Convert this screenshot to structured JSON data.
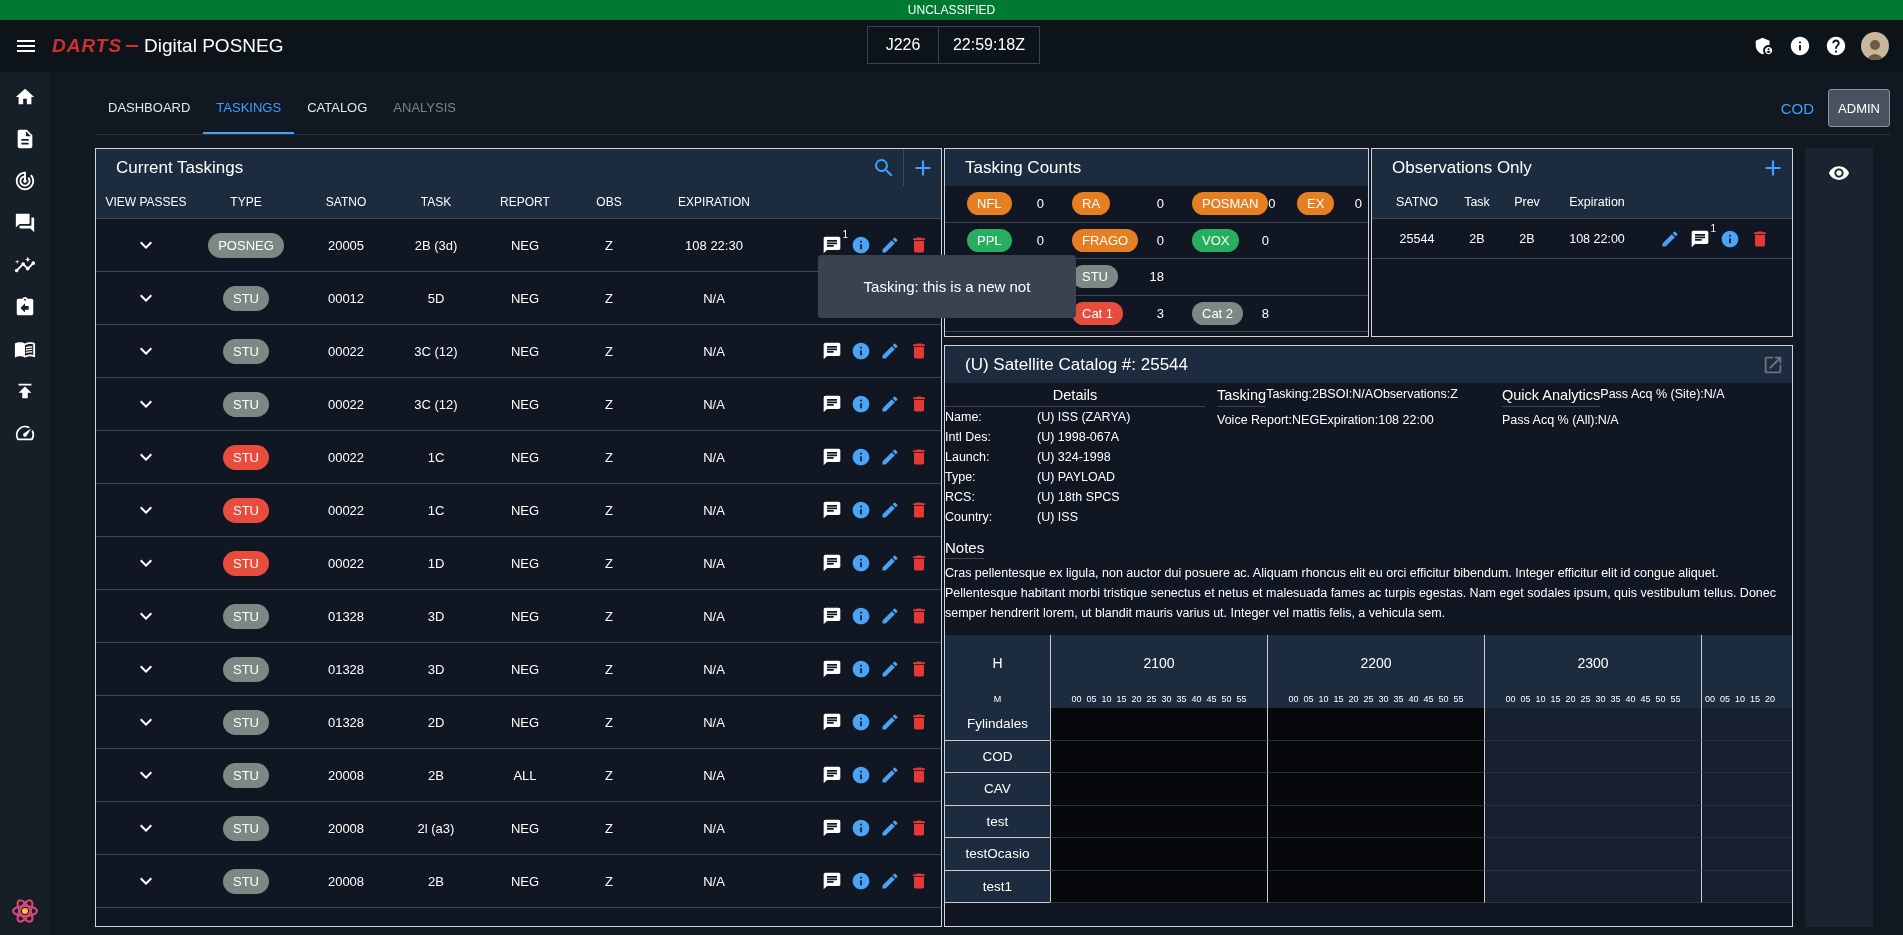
{
  "banner": "UNCLASSIFIED",
  "header": {
    "logo": "DARTS",
    "title": "Digital POSNEG",
    "julian": "J226",
    "clock": "22:59:18Z"
  },
  "nav_tabs": [
    {
      "label": "DASHBOARD",
      "selected": false,
      "disabled": false
    },
    {
      "label": "TASKINGS",
      "selected": true,
      "disabled": false
    },
    {
      "label": "CATALOG",
      "selected": false,
      "disabled": false
    },
    {
      "label": "ANALYSIS",
      "selected": false,
      "disabled": true
    }
  ],
  "site_link": "COD",
  "admin_button": "ADMIN",
  "taskings": {
    "title": "Current Taskings",
    "columns": [
      "VIEW PASSES",
      "TYPE",
      "SATNO",
      "TASK",
      "REPORT",
      "OBS",
      "EXPIRATION"
    ],
    "rows": [
      {
        "type": "POSNEG",
        "color": "#7d8784",
        "satno": "20005",
        "task": "2B (3d)",
        "report": "NEG",
        "obs": "Z",
        "expiration": "108 22:30",
        "comments": "1"
      },
      {
        "type": "STU",
        "color": "#7d8784",
        "satno": "00012",
        "task": "5D",
        "report": "NEG",
        "obs": "Z",
        "expiration": "N/A",
        "covered_actions": true
      },
      {
        "type": "STU",
        "color": "#7d8784",
        "satno": "00022",
        "task": "3C (12)",
        "report": "NEG",
        "obs": "Z",
        "expiration": "N/A"
      },
      {
        "type": "STU",
        "color": "#7d8784",
        "satno": "00022",
        "task": "3C (12)",
        "report": "NEG",
        "obs": "Z",
        "expiration": "N/A"
      },
      {
        "type": "STU",
        "color": "#e74c3c",
        "satno": "00022",
        "task": "1C",
        "report": "NEG",
        "obs": "Z",
        "expiration": "N/A"
      },
      {
        "type": "STU",
        "color": "#e74c3c",
        "satno": "00022",
        "task": "1C",
        "report": "NEG",
        "obs": "Z",
        "expiration": "N/A"
      },
      {
        "type": "STU",
        "color": "#e74c3c",
        "satno": "00022",
        "task": "1D",
        "report": "NEG",
        "obs": "Z",
        "expiration": "N/A"
      },
      {
        "type": "STU",
        "color": "#7d8784",
        "satno": "01328",
        "task": "3D",
        "report": "NEG",
        "obs": "Z",
        "expiration": "N/A"
      },
      {
        "type": "STU",
        "color": "#7d8784",
        "satno": "01328",
        "task": "3D",
        "report": "NEG",
        "obs": "Z",
        "expiration": "N/A"
      },
      {
        "type": "STU",
        "color": "#7d8784",
        "satno": "01328",
        "task": "2D",
        "report": "NEG",
        "obs": "Z",
        "expiration": "N/A"
      },
      {
        "type": "STU",
        "color": "#7d8784",
        "satno": "20008",
        "task": "2B",
        "report": "ALL",
        "obs": "Z",
        "expiration": "N/A"
      },
      {
        "type": "STU",
        "color": "#7d8784",
        "satno": "20008",
        "task": "2l (a3)",
        "report": "NEG",
        "obs": "Z",
        "expiration": "N/A"
      },
      {
        "type": "STU",
        "color": "#7d8784",
        "satno": "20008",
        "task": "2B",
        "report": "NEG",
        "obs": "Z",
        "expiration": "N/A"
      }
    ]
  },
  "tooltip": "Tasking: this is a new not",
  "counts": {
    "title": "Tasking Counts",
    "rows": [
      [
        {
          "kind": "count",
          "label": "NFL",
          "color": "#e67e22",
          "count": "0"
        },
        {
          "kind": "count",
          "label": "RA",
          "color": "#e67e22",
          "count": "0"
        },
        {
          "kind": "count",
          "label": "POSMAN",
          "color": "#e67e22",
          "count": "0"
        },
        {
          "kind": "count",
          "label": "EX",
          "color": "#e67e22",
          "count": "0"
        }
      ],
      [
        {
          "kind": "count",
          "label": "PPL",
          "color": "#27ae60",
          "count": "0"
        },
        {
          "kind": "count",
          "label": "FRAGO",
          "color": "#e67e22",
          "count": "0"
        },
        {
          "kind": "count",
          "label": "VOX",
          "color": "#27ae60",
          "count": "0"
        }
      ],
      [
        {
          "kind": "covered"
        },
        {
          "kind": "count",
          "label": "STU",
          "color": "#7d8784",
          "count": "18"
        }
      ],
      [
        {
          "kind": "covered"
        },
        {
          "kind": "count",
          "label": "Cat 1",
          "color": "#e74c3c",
          "count": "3"
        },
        {
          "kind": "count",
          "label": "Cat 2",
          "color": "#7d8784",
          "count": "8"
        }
      ]
    ]
  },
  "observations": {
    "title": "Observations Only",
    "columns": [
      "SATNO",
      "Task",
      "Prev",
      "Expiration"
    ],
    "rows": [
      {
        "satno": "25544",
        "task": "2B",
        "prev": "2B",
        "expiration": "108 22:00",
        "comments": "1"
      }
    ]
  },
  "catalog": {
    "title": "(U) Satellite Catalog #: 25544",
    "details_title": "Details",
    "details": [
      {
        "label": "Name:",
        "value": "(U) ISS (ZARYA)"
      },
      {
        "label": "Intl Des:",
        "value": "(U) 1998-067A"
      },
      {
        "label": "Launch:",
        "value": "(U) 324-1998"
      },
      {
        "label": "Type:",
        "value": "(U) PAYLOAD"
      },
      {
        "label": "RCS:",
        "value": "(U) 18th SPCS"
      },
      {
        "label": "Country:",
        "value": "(U) ISS"
      }
    ],
    "tasking_title": "Tasking",
    "tasking_lines": [
      "Tasking:2BSOI:N/AObservations:Z",
      "Voice Report:NEGExpiration:108 22:00"
    ],
    "analytics_title": "Quick Analytics",
    "analytics_lines": [
      "Pass Acq % (Site):N/A",
      "Pass Acq % (All):N/A"
    ],
    "notes_title": "Notes",
    "notes": "Cras pellentesque ex ligula, non auctor dui posuere ac. Aliquam rhoncus elit eu orci efficitur bibendum. Integer efficitur elit id congue aliquet. Pellentesque habitant morbi tristique senectus et netus et malesuada fames ac turpis egestas. Nam eget sodales ipsum, quis vestibulum tellus. Donec semper hendrerit lorem, ut blandit mauris varius ut. Integer vel mattis felis, a vehicula sem."
  },
  "timeline": {
    "hour_label": "H",
    "minute_label": "M",
    "hours": [
      {
        "hour": "2100",
        "elapsed": true,
        "minutes": [
          "00",
          "05",
          "10",
          "15",
          "20",
          "25",
          "30",
          "35",
          "40",
          "45",
          "50",
          "55"
        ]
      },
      {
        "hour": "2200",
        "elapsed": true,
        "minutes": [
          "00",
          "05",
          "10",
          "15",
          "20",
          "25",
          "30",
          "35",
          "40",
          "45",
          "50",
          "55"
        ]
      },
      {
        "hour": "2300",
        "elapsed": false,
        "minutes": [
          "00",
          "05",
          "10",
          "15",
          "20",
          "25",
          "30",
          "35",
          "40",
          "45",
          "50",
          "55"
        ]
      },
      {
        "elapsed": false,
        "minutes": [
          "00",
          "05",
          "10",
          "15",
          "20"
        ]
      }
    ],
    "sites": [
      "Fylindales",
      "COD",
      "CAV",
      "test",
      "testOcasio",
      "test1"
    ]
  }
}
